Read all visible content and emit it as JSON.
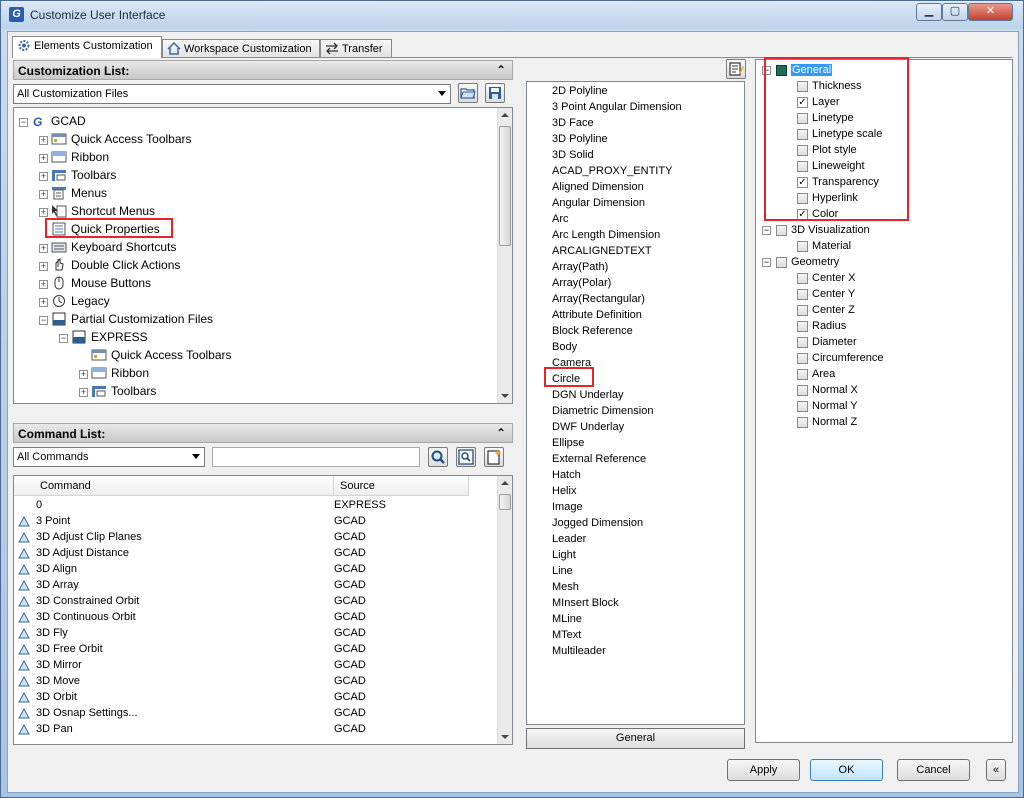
{
  "window": {
    "title": "Customize User Interface",
    "app_icon_letter": "G"
  },
  "tabs": [
    {
      "label": "Elements Customization"
    },
    {
      "label": "Workspace Customization"
    },
    {
      "label": "Transfer"
    }
  ],
  "customization_list": {
    "header": "Customization List:",
    "combo_value": "All Customization Files",
    "tree": [
      {
        "label": "GCAD",
        "icon": "gcad-logo-icon",
        "level": 0,
        "expander": "−"
      },
      {
        "label": "Quick Access Toolbars",
        "icon": "quick-access-toolbar-icon",
        "level": 1,
        "expander": "+"
      },
      {
        "label": "Ribbon",
        "icon": "ribbon-icon",
        "level": 1,
        "expander": "+"
      },
      {
        "label": "Toolbars",
        "icon": "toolbars-icon",
        "level": 1,
        "expander": "+"
      },
      {
        "label": "Menus",
        "icon": "menus-icon",
        "level": 1,
        "expander": "+"
      },
      {
        "label": "Shortcut Menus",
        "icon": "shortcut-menus-icon",
        "level": 1,
        "expander": "+"
      },
      {
        "label": "Quick Properties",
        "icon": "quick-properties-icon",
        "level": 1,
        "expander": ""
      },
      {
        "label": "Keyboard Shortcuts",
        "icon": "keyboard-shortcuts-icon",
        "level": 1,
        "expander": "+"
      },
      {
        "label": "Double Click Actions",
        "icon": "double-click-icon",
        "level": 1,
        "expander": "+"
      },
      {
        "label": "Mouse Buttons",
        "icon": "mouse-icon",
        "level": 1,
        "expander": "+"
      },
      {
        "label": "Legacy",
        "icon": "legacy-icon",
        "level": 1,
        "expander": "+"
      },
      {
        "label": "Partial Customization Files",
        "icon": "partial-cui-icon",
        "level": 1,
        "expander": "−"
      },
      {
        "label": "EXPRESS",
        "icon": "cui-file-icon",
        "level": 2,
        "expander": "−"
      },
      {
        "label": "Quick Access Toolbars",
        "icon": "quick-access-toolbar-icon",
        "level": 3,
        "expander": ""
      },
      {
        "label": "Ribbon",
        "icon": "ribbon-icon",
        "level": 3,
        "expander": "+"
      },
      {
        "label": "Toolbars",
        "icon": "toolbars-icon",
        "level": 3,
        "expander": "+"
      }
    ]
  },
  "command_list": {
    "header": "Command List:",
    "combo_value": "All Commands",
    "search_value": "",
    "columns": {
      "command": "Command",
      "source": "Source"
    },
    "rows": [
      {
        "command": "0",
        "source": "EXPRESS"
      },
      {
        "command": "3 Point",
        "source": "GCAD"
      },
      {
        "command": "3D Adjust Clip Planes",
        "source": "GCAD"
      },
      {
        "command": "3D Adjust Distance",
        "source": "GCAD"
      },
      {
        "command": "3D Align",
        "source": "GCAD"
      },
      {
        "command": "3D Array",
        "source": "GCAD"
      },
      {
        "command": "3D Constrained Orbit",
        "source": "GCAD"
      },
      {
        "command": "3D Continuous Orbit",
        "source": "GCAD"
      },
      {
        "command": "3D Fly",
        "source": "GCAD"
      },
      {
        "command": "3D Free Orbit",
        "source": "GCAD"
      },
      {
        "command": "3D Mirror",
        "source": "GCAD"
      },
      {
        "command": "3D Move",
        "source": "GCAD"
      },
      {
        "command": "3D Orbit",
        "source": "GCAD"
      },
      {
        "command": "3D Osnap Settings...",
        "source": "GCAD"
      },
      {
        "command": "3D Pan",
        "source": "GCAD"
      }
    ]
  },
  "object_types": {
    "items": [
      "2D Polyline",
      "3 Point Angular Dimension",
      "3D Face",
      "3D Polyline",
      "3D Solid",
      "ACAD_PROXY_ENTITY",
      "Aligned Dimension",
      "Angular Dimension",
      "Arc",
      "Arc Length Dimension",
      "ARCALIGNEDTEXT",
      "Array(Path)",
      "Array(Polar)",
      "Array(Rectangular)",
      "Attribute Definition",
      "Block Reference",
      "Body",
      "Camera",
      "Circle",
      "DGN Underlay",
      "Diametric Dimension",
      "DWF Underlay",
      "Ellipse",
      "External Reference",
      "Hatch",
      "Helix",
      "Image",
      "Jogged Dimension",
      "Leader",
      "Light",
      "Line",
      "Mesh",
      "MInsert Block",
      "MLine",
      "MText",
      "Multileader"
    ],
    "footer_button": "General"
  },
  "properties": {
    "groups": [
      {
        "label": "General",
        "checked": true,
        "items": [
          {
            "label": "Thickness",
            "checked": false
          },
          {
            "label": "Layer",
            "checked": true
          },
          {
            "label": "Linetype",
            "checked": false
          },
          {
            "label": "Linetype scale",
            "checked": false
          },
          {
            "label": "Plot style",
            "checked": false
          },
          {
            "label": "Lineweight",
            "checked": false
          },
          {
            "label": "Transparency",
            "checked": true
          },
          {
            "label": "Hyperlink",
            "checked": false
          },
          {
            "label": "Color",
            "checked": true
          }
        ]
      },
      {
        "label": "3D Visualization",
        "checked": false,
        "items": [
          {
            "label": "Material",
            "checked": false
          }
        ]
      },
      {
        "label": "Geometry",
        "checked": false,
        "items": [
          {
            "label": "Center X",
            "checked": false
          },
          {
            "label": "Center Y",
            "checked": false
          },
          {
            "label": "Center Z",
            "checked": false
          },
          {
            "label": "Radius",
            "checked": false
          },
          {
            "label": "Diameter",
            "checked": false
          },
          {
            "label": "Circumference",
            "checked": false
          },
          {
            "label": "Area",
            "checked": false
          },
          {
            "label": "Normal X",
            "checked": false
          },
          {
            "label": "Normal Y",
            "checked": false
          },
          {
            "label": "Normal Z",
            "checked": false
          }
        ]
      }
    ]
  },
  "footer": {
    "apply": "Apply",
    "ok": "OK",
    "cancel": "Cancel",
    "collapse": "«"
  },
  "colors": {
    "highlight_red": "#e8232a",
    "selection_blue": "#3399ff"
  }
}
